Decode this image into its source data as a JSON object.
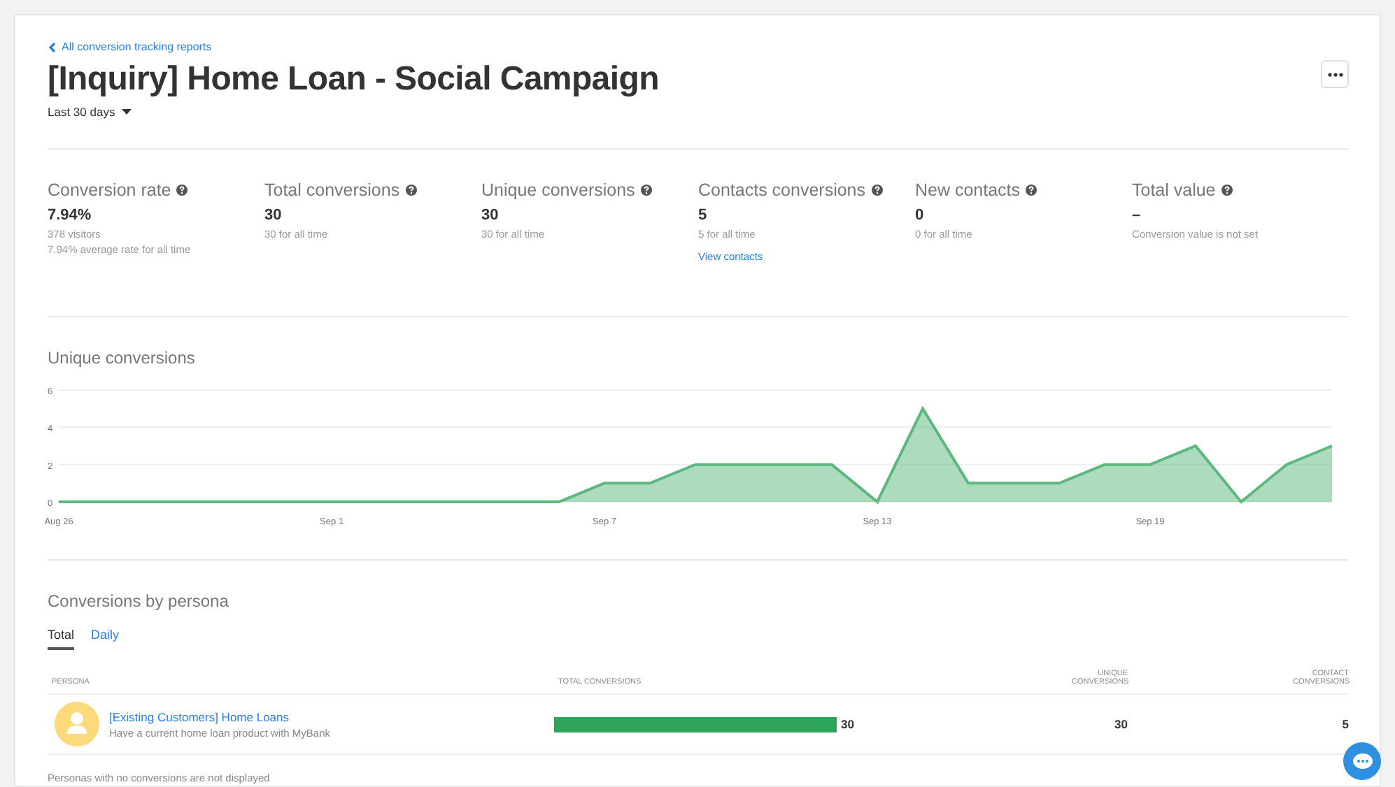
{
  "back_link": "All conversion tracking reports",
  "title": "[Inquiry] Home Loan - Social Campaign",
  "date_range": "Last 30 days",
  "metrics": [
    {
      "label": "Conversion rate",
      "value": "7.94%",
      "notes": [
        "378 visitors",
        "7.94% average rate for all time"
      ]
    },
    {
      "label": "Total conversions",
      "value": "30",
      "notes": [
        "30 for all time"
      ]
    },
    {
      "label": "Unique conversions",
      "value": "30",
      "notes": [
        "30 for all time"
      ]
    },
    {
      "label": "Contacts conversions",
      "value": "5",
      "notes": [
        "5 for all time"
      ],
      "link": "View contacts"
    },
    {
      "label": "New contacts",
      "value": "0",
      "notes": [
        "0 for all time"
      ]
    },
    {
      "label": "Total value",
      "value": "–",
      "notes": [
        "Conversion value is not set"
      ]
    }
  ],
  "unique_chart": {
    "title": "Unique conversions",
    "chart_data": {
      "type": "area",
      "categories": [
        "Aug 26",
        null,
        null,
        null,
        null,
        null,
        "Sep 1",
        null,
        null,
        null,
        null,
        null,
        "Sep 7",
        null,
        null,
        null,
        null,
        null,
        "Sep 13",
        null,
        null,
        null,
        null,
        null,
        "Sep 19",
        null,
        null,
        null,
        null
      ],
      "series": [
        {
          "color": "#5cb87e",
          "values": [
            0,
            0,
            0,
            0,
            0,
            0,
            0,
            0,
            0,
            0,
            0,
            0,
            1,
            1,
            2,
            2,
            2,
            2,
            0,
            5,
            1,
            1,
            1,
            2,
            2,
            3,
            0,
            2,
            3
          ]
        }
      ],
      "ylim": [
        0,
        6
      ],
      "yticks": [
        0,
        2,
        4,
        6
      ]
    }
  },
  "persona_section": {
    "title": "Conversions by persona",
    "tabs": [
      {
        "label": "Total",
        "selected": true
      },
      {
        "label": "Daily",
        "selected": false
      }
    ],
    "columns": [
      "PERSONA",
      "TOTAL CONVERSIONS",
      "UNIQUE CONVERSIONS",
      "CONTACT CONVERSIONS"
    ],
    "rows": [
      {
        "name": "[Existing Customers] Home Loans",
        "description": "Have a current home loan product with MyBank",
        "total": "30",
        "unique": "30",
        "contacts": "5"
      }
    ],
    "footnote": "Personas with no conversions are not displayed"
  }
}
